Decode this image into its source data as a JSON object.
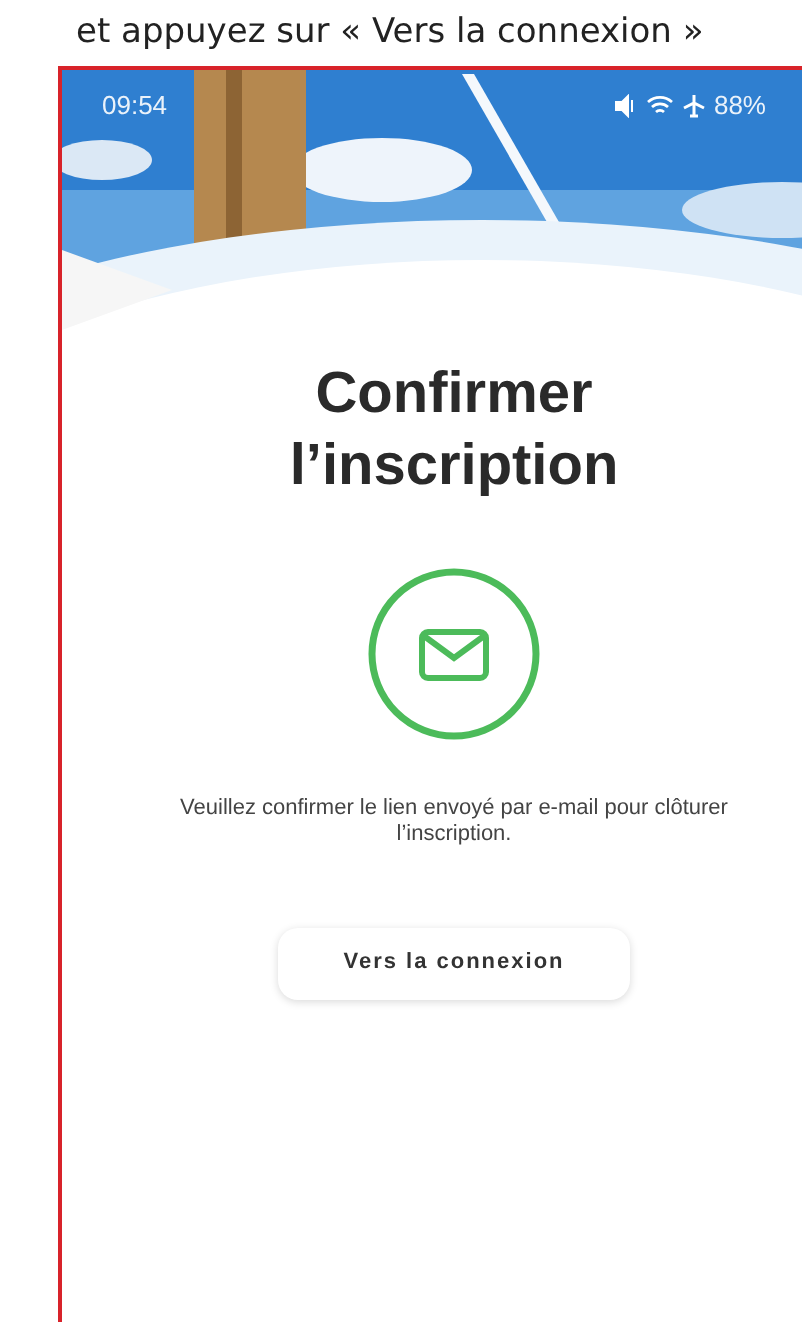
{
  "caption": "et appuyez sur « Vers la connexion »",
  "status_bar": {
    "time": "09:54",
    "battery": "88%"
  },
  "title": "Confirmer l’inscription",
  "message": "Veuillez confirmer le lien envoyé par e-mail pour clôturer l’inscription.",
  "button": {
    "label": "Vers la connexion"
  }
}
